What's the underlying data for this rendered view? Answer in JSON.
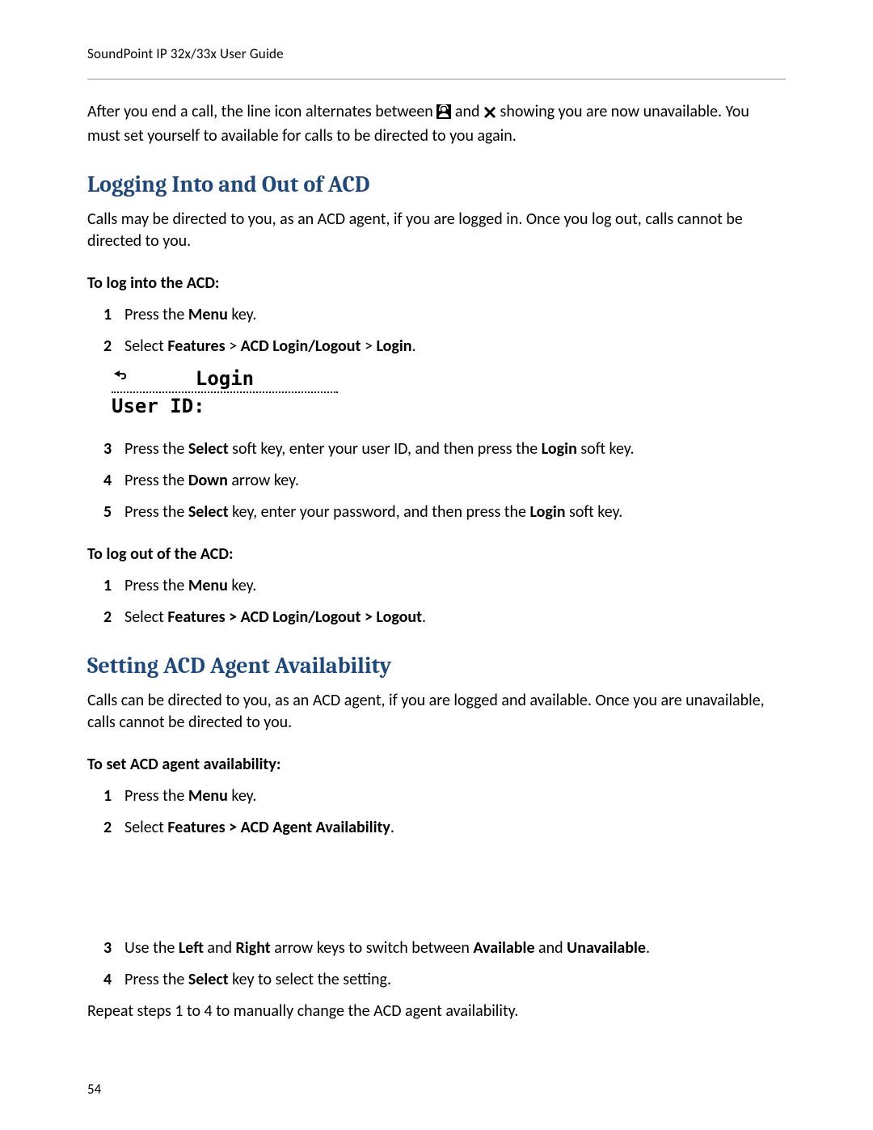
{
  "header": {
    "title": "SoundPoint IP 32x/33x User Guide"
  },
  "intro": {
    "t1": "After you end a call, the line icon alternates between ",
    "t2": " and ",
    "t3": " showing you are now unavailable. You must set yourself to available for calls to be directed to you again."
  },
  "section1": {
    "heading": "Logging Into and Out of ACD",
    "desc": "Calls may be directed to you, as an ACD agent, if you are logged in. Once you log out, calls cannot be directed to you.",
    "login_title": "To log into the ACD:",
    "login_steps": [
      {
        "p1": "Press the ",
        "b1": "Menu",
        "p2": " key."
      },
      {
        "p1": "Select ",
        "b1": "Features",
        "p2": " > ",
        "b2": "ACD Login/Logout",
        "p3": " > ",
        "b3": "Login",
        "p4": "."
      }
    ],
    "screen": {
      "title": "Login",
      "line2": "User ID:"
    },
    "login_steps2": [
      {
        "p1": "Press the ",
        "b1": "Select",
        "p2": " soft key, enter your user ID, and then press the ",
        "b2": "Login",
        "p3": " soft key."
      },
      {
        "p1": "Press the ",
        "b1": "Down",
        "p2": " arrow key."
      },
      {
        "p1": "Press the ",
        "b1": "Select",
        "p2": " key, enter your password, and then press the ",
        "b2": "Login",
        "p3": " soft key."
      }
    ],
    "logout_title": "To log out of the ACD:",
    "logout_steps": [
      {
        "p1": "Press the ",
        "b1": "Menu",
        "p2": " key."
      },
      {
        "p1": "Select ",
        "b1": "Features > ACD Login/Logout > Logout",
        "p2": "."
      }
    ]
  },
  "section2": {
    "heading": "Setting ACD Agent Availability",
    "desc": "Calls can be directed to you, as an ACD agent, if you are logged and available. Once you are unavailable, calls cannot be directed to you.",
    "title": "To set ACD agent availability:",
    "stepsA": [
      {
        "p1": "Press the ",
        "b1": "Menu",
        "p2": " key."
      },
      {
        "p1": "Select ",
        "b1": "Features > ACD Agent Availability",
        "p2": "."
      }
    ],
    "stepsB": [
      {
        "p1": "Use the ",
        "b1": "Left",
        "p2": " and ",
        "b2": "Right",
        "p3": " arrow keys to switch between ",
        "b3": "Available",
        "p4": " and ",
        "b4": "Unavailable",
        "p5": "."
      },
      {
        "p1": "Press the ",
        "b1": "Select",
        "p2": " key to select the setting."
      }
    ],
    "closing": "Repeat steps 1 to 4 to manually change the ACD agent availability."
  },
  "page_number": "54"
}
